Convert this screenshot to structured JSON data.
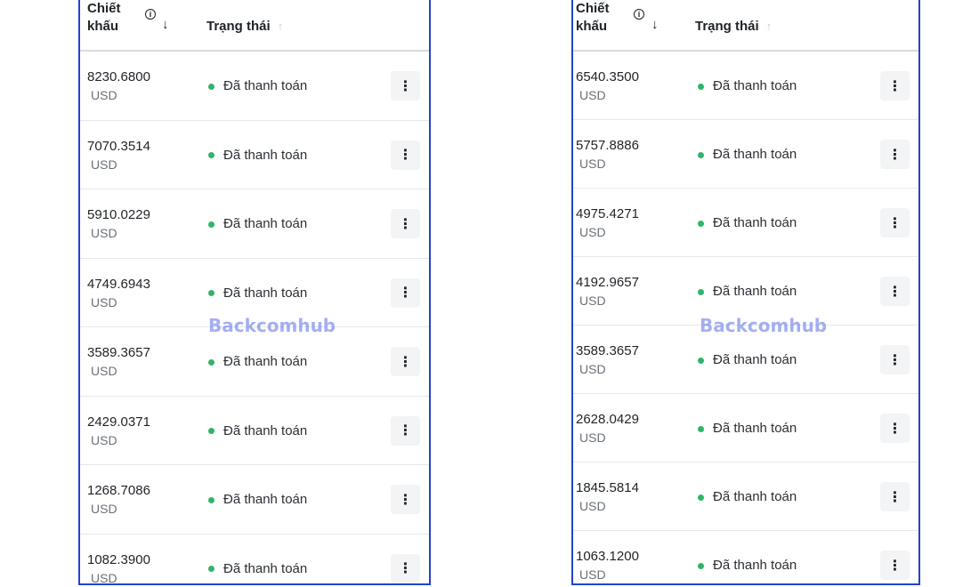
{
  "table": {
    "header": {
      "discount_label": "Chiết khấu",
      "status_label": "Trạng thái",
      "info_icon": "info-circle-icon",
      "sort_down_icon": "arrow-down-icon",
      "sort_up_icon": "arrow-up-icon"
    },
    "currency": "USD",
    "status_paid": "Đã thanh toán",
    "menu_icon": "more-vertical-icon"
  },
  "left_panel": {
    "rows": [
      {
        "amount": "8230.6800",
        "currency": "USD",
        "status": "Đã thanh toán"
      },
      {
        "amount": "7070.3514",
        "currency": "USD",
        "status": "Đã thanh toán"
      },
      {
        "amount": "5910.0229",
        "currency": "USD",
        "status": "Đã thanh toán"
      },
      {
        "amount": "4749.6943",
        "currency": "USD",
        "status": "Đã thanh toán"
      },
      {
        "amount": "3589.3657",
        "currency": "USD",
        "status": "Đã thanh toán"
      },
      {
        "amount": "2429.0371",
        "currency": "USD",
        "status": "Đã thanh toán"
      },
      {
        "amount": "1268.7086",
        "currency": "USD",
        "status": "Đã thanh toán"
      },
      {
        "amount": "1082.3900",
        "currency": "USD",
        "status": "Đã thanh toán"
      }
    ]
  },
  "right_panel": {
    "rows": [
      {
        "amount": "6540.3500",
        "currency": "USD",
        "status": "Đã thanh toán"
      },
      {
        "amount": "5757.8886",
        "currency": "USD",
        "status": "Đã thanh toán"
      },
      {
        "amount": "4975.4271",
        "currency": "USD",
        "status": "Đã thanh toán"
      },
      {
        "amount": "4192.9657",
        "currency": "USD",
        "status": "Đã thanh toán"
      },
      {
        "amount": "3589.3657",
        "currency": "USD",
        "status": "Đã thanh toán"
      },
      {
        "amount": "2628.0429",
        "currency": "USD",
        "status": "Đã thanh toán"
      },
      {
        "amount": "1845.5814",
        "currency": "USD",
        "status": "Đã thanh toán"
      },
      {
        "amount": "1063.1200",
        "currency": "USD",
        "status": "Đã thanh toán"
      }
    ]
  },
  "watermark": "Backcomhub",
  "colors": {
    "panel_border": "#2244cc",
    "status_dot": "#2fb56a",
    "watermark": "#5a6ee6"
  }
}
